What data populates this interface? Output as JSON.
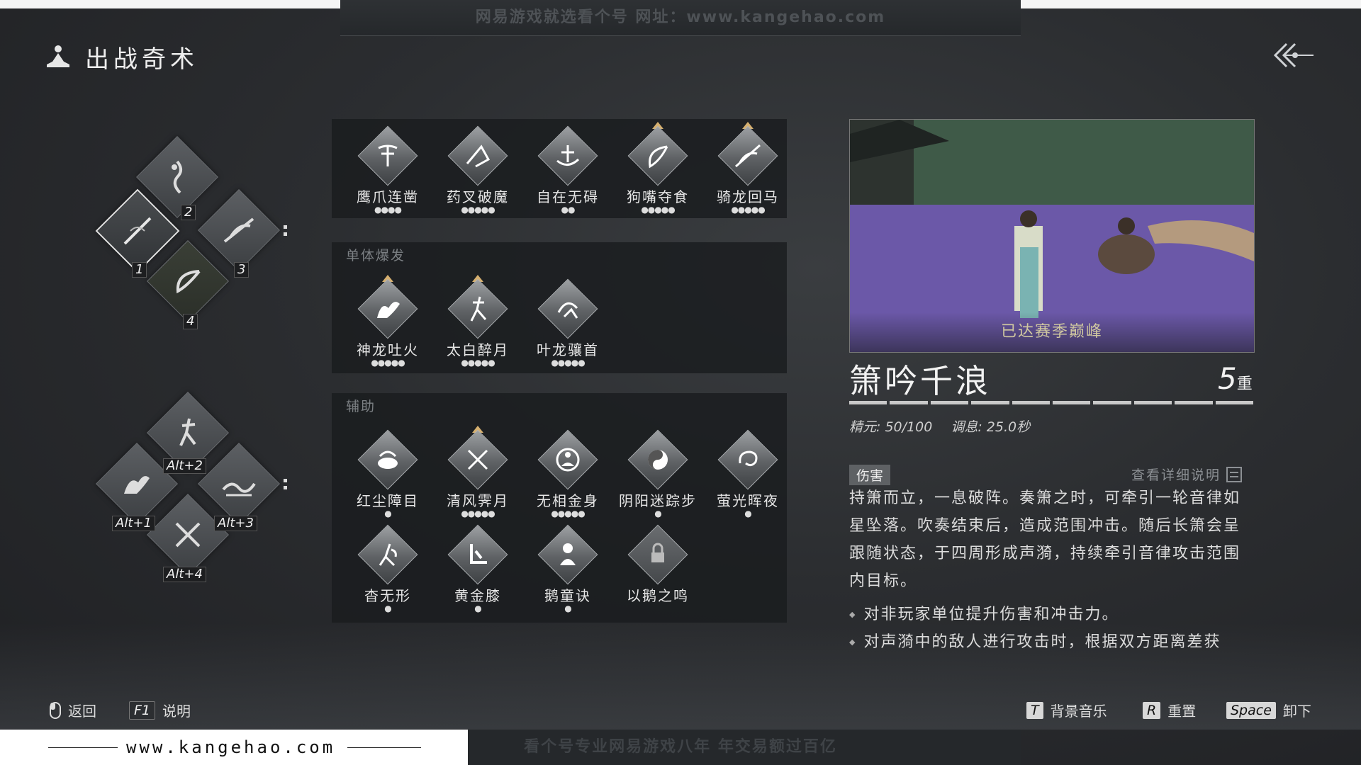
{
  "page": {
    "title": "出战奇术"
  },
  "watermarks": {
    "top": "网易游戏就选看个号  网址：www.kangehao.com",
    "bottom": "看个号专业网易游戏八年  年交易额过百亿",
    "site": "www.kangehao.com"
  },
  "loadout_primary": {
    "keys": [
      "1",
      "2",
      "3",
      "4"
    ]
  },
  "loadout_alt": {
    "keys": [
      "Alt+1",
      "Alt+2",
      "Alt+3",
      "Alt+4"
    ]
  },
  "skills_top": [
    {
      "name": "鹰爪连凿",
      "pips": "●●●●"
    },
    {
      "name": "药叉破魔",
      "pips": "●●●●●"
    },
    {
      "name": "自在无碍",
      "pips": "●●"
    },
    {
      "name": "狗嘴夺食",
      "pips": "●●●●●"
    },
    {
      "name": "骑龙回马",
      "pips": "●●●●●"
    }
  ],
  "burst": {
    "label": "单体爆发",
    "skills": [
      {
        "name": "神龙吐火",
        "pips": "●●●●●"
      },
      {
        "name": "太白醉月",
        "pips": "●●●●●"
      },
      {
        "name": "叶龙骧首",
        "pips": "●●●●●"
      }
    ]
  },
  "support": {
    "label": "辅助",
    "skills": [
      {
        "name": "红尘障目",
        "pips": "●"
      },
      {
        "name": "清风霁月",
        "pips": "●●●●●"
      },
      {
        "name": "无相金身",
        "pips": "●●●●●"
      },
      {
        "name": "阴阳迷踪步",
        "pips": "●"
      },
      {
        "name": "萤光晖夜",
        "pips": "●"
      },
      {
        "name": "杳无形",
        "pips": "●"
      },
      {
        "name": "黄金膝",
        "pips": "●"
      },
      {
        "name": "鹅童诀",
        "pips": "●"
      },
      {
        "name": "以鹅之鸣",
        "pips": ""
      }
    ]
  },
  "detail": {
    "caption": "已达赛季巅峰",
    "name": "箫吟千浪",
    "level": "5",
    "level_unit": "重",
    "stat_energy": "精元: 50/100",
    "stat_cooldown": "调息: 25.0秒",
    "tag": "伤害",
    "detail_link": "查看详细说明",
    "description": "持箫而立，一息破阵。奏箫之时，可牵引一轮音律如星坠落。吹奏结束后，造成范围冲击。随后长箫会呈跟随状态，于四周形成声漪，持续牵引音律攻击范围内目标。",
    "bullets": [
      "对非玩家单位提升伤害和冲击力。",
      "对声漪中的敌人进行攻击时，根据双方距离差获"
    ]
  },
  "hints": {
    "back": "返回",
    "f1_key": "F1",
    "f1_label": "说明",
    "t_key": "T",
    "t_label": "背景音乐",
    "r_key": "R",
    "r_label": "重置",
    "space_key": "Space",
    "space_label": "卸下"
  },
  "colors": {
    "accent_gold": "#d6b070",
    "panel_bg": "#1a1c1f"
  }
}
